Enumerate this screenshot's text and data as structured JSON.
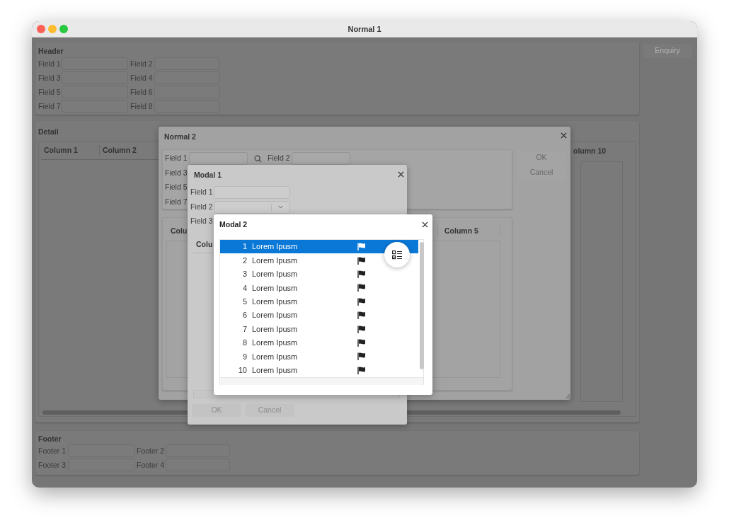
{
  "window": {
    "title": "Normal 1"
  },
  "header": {
    "title": "Header",
    "fields": [
      {
        "label": "Field 1"
      },
      {
        "label": "Field 2"
      },
      {
        "label": "Field 3"
      },
      {
        "label": "Field 4"
      },
      {
        "label": "Field 5"
      },
      {
        "label": "Field 6"
      },
      {
        "label": "Field 7"
      },
      {
        "label": "Field 8"
      }
    ]
  },
  "enquiry_button": "Enquiry",
  "detail": {
    "title": "Detail",
    "columns": [
      "Column 1",
      "Column 2",
      "olumn 10"
    ]
  },
  "footer": {
    "title": "Footer",
    "fields": [
      {
        "label": "Footer 1"
      },
      {
        "label": "Footer 2"
      },
      {
        "label": "Footer 3"
      },
      {
        "label": "Footer 4"
      }
    ]
  },
  "normal_2": {
    "title": "Normal 2",
    "fields": [
      {
        "label": "Field 1",
        "kind": "search"
      },
      {
        "label": "Field 2",
        "kind": "text"
      },
      {
        "label": "Field 3",
        "kind": "label"
      },
      {
        "label": "Field 5",
        "kind": "label"
      },
      {
        "label": "Field 7",
        "kind": "label"
      }
    ],
    "buttons": [
      "OK",
      "Cancel"
    ],
    "columns": [
      "Colu",
      "Column 5"
    ]
  },
  "modal_1": {
    "title": "Modal 1",
    "fields": [
      {
        "label": "Field 1",
        "kind": "text"
      },
      {
        "label": "Field 2",
        "kind": "dropdown"
      },
      {
        "label": "Field 3",
        "kind": "label"
      }
    ],
    "columns": [
      "Colu"
    ],
    "buttons": [
      "OK",
      "Cancel"
    ]
  },
  "modal_2": {
    "title": "Modal 2",
    "rows": [
      {
        "number": "1",
        "text": "Lorem Ipusm",
        "selected": true
      },
      {
        "number": "2",
        "text": "Lorem Ipusm",
        "selected": false
      },
      {
        "number": "3",
        "text": "Lorem Ipusm",
        "selected": false
      },
      {
        "number": "4",
        "text": "Lorem Ipusm",
        "selected": false
      },
      {
        "number": "5",
        "text": "Lorem Ipusm",
        "selected": false
      },
      {
        "number": "6",
        "text": "Lorem Ipusm",
        "selected": false
      },
      {
        "number": "7",
        "text": "Lorem Ipusm",
        "selected": false
      },
      {
        "number": "8",
        "text": "Lorem Ipusm",
        "selected": false
      },
      {
        "number": "9",
        "text": "Lorem Ipusm",
        "selected": false
      },
      {
        "number": "10",
        "text": "Lorem Ipusm",
        "selected": false
      }
    ]
  }
}
